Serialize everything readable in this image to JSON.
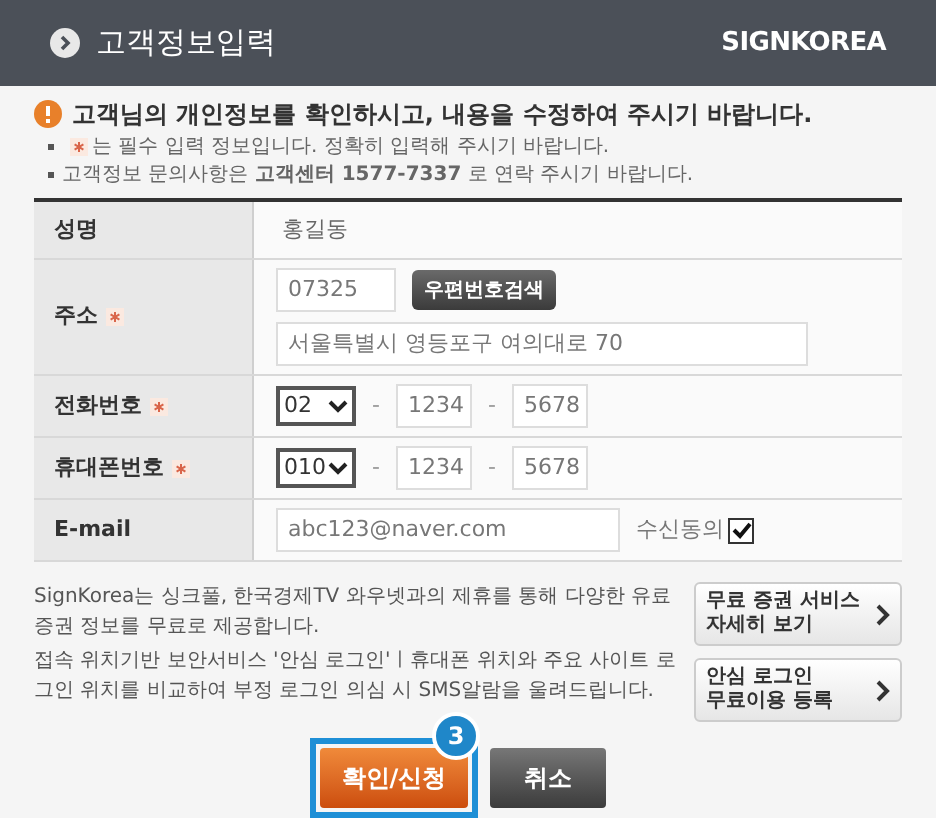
{
  "header": {
    "title": "고객정보입력",
    "logo": "SIGNKOREA"
  },
  "notice": {
    "heading": "고객님의 개인정보를 확인하시고, 내용을 수정하여 주시기 바랍니다.",
    "bullets": [
      {
        "kind": "required",
        "text": "는 필수 입력 정보입니다. 정확히 입력해 주시기 바랍니다."
      },
      {
        "kind": "plain",
        "text": "고객정보 문의사항은 **고객센터 1577-7337** 로 연락 주시기 바랍니다."
      }
    ]
  },
  "form": [
    {
      "kind": "static",
      "label": "성명",
      "required": false,
      "value": "홍길동"
    },
    {
      "kind": "address",
      "label": "주소",
      "required": true,
      "zip": "07325",
      "button": "우편번호검색",
      "address": "서울특별시 영등포구 여의대로 70"
    },
    {
      "kind": "phone",
      "label": "전화번호",
      "required": true,
      "prefix": "02",
      "middle": "1234",
      "last": "5678",
      "separator": "-"
    },
    {
      "kind": "phone",
      "label": "휴대폰번호",
      "required": true,
      "prefix": "010",
      "middle": "1234",
      "last": "5678",
      "separator": "-"
    },
    {
      "kind": "email",
      "label": "E-mail",
      "required": false,
      "value": "abc123@naver.com",
      "consent_label": "수신동의",
      "consent_checked": true
    }
  ],
  "info": {
    "paragraphs": [
      "SignKorea는 싱크풀, 한국경제TV 와우넷과의 제휴를 통해 다양한 유료증권 정보를 무료로 제공합니다.",
      "접속 위치기반 보안서비스 '안심 로그인'ㅣ휴대폰 위치와 주요 사이트 로그인 위치를 비교하여 부정 로그인 의심 시 SMS알람을 울려드립니다."
    ],
    "links": [
      {
        "line1": "무료 증권 서비스",
        "line2": "자세히 보기"
      },
      {
        "line1": "안심 로그인",
        "line2": "무료이용 등록"
      }
    ]
  },
  "actions": {
    "step": "3",
    "confirm": "확인/신청",
    "cancel": "취소"
  }
}
